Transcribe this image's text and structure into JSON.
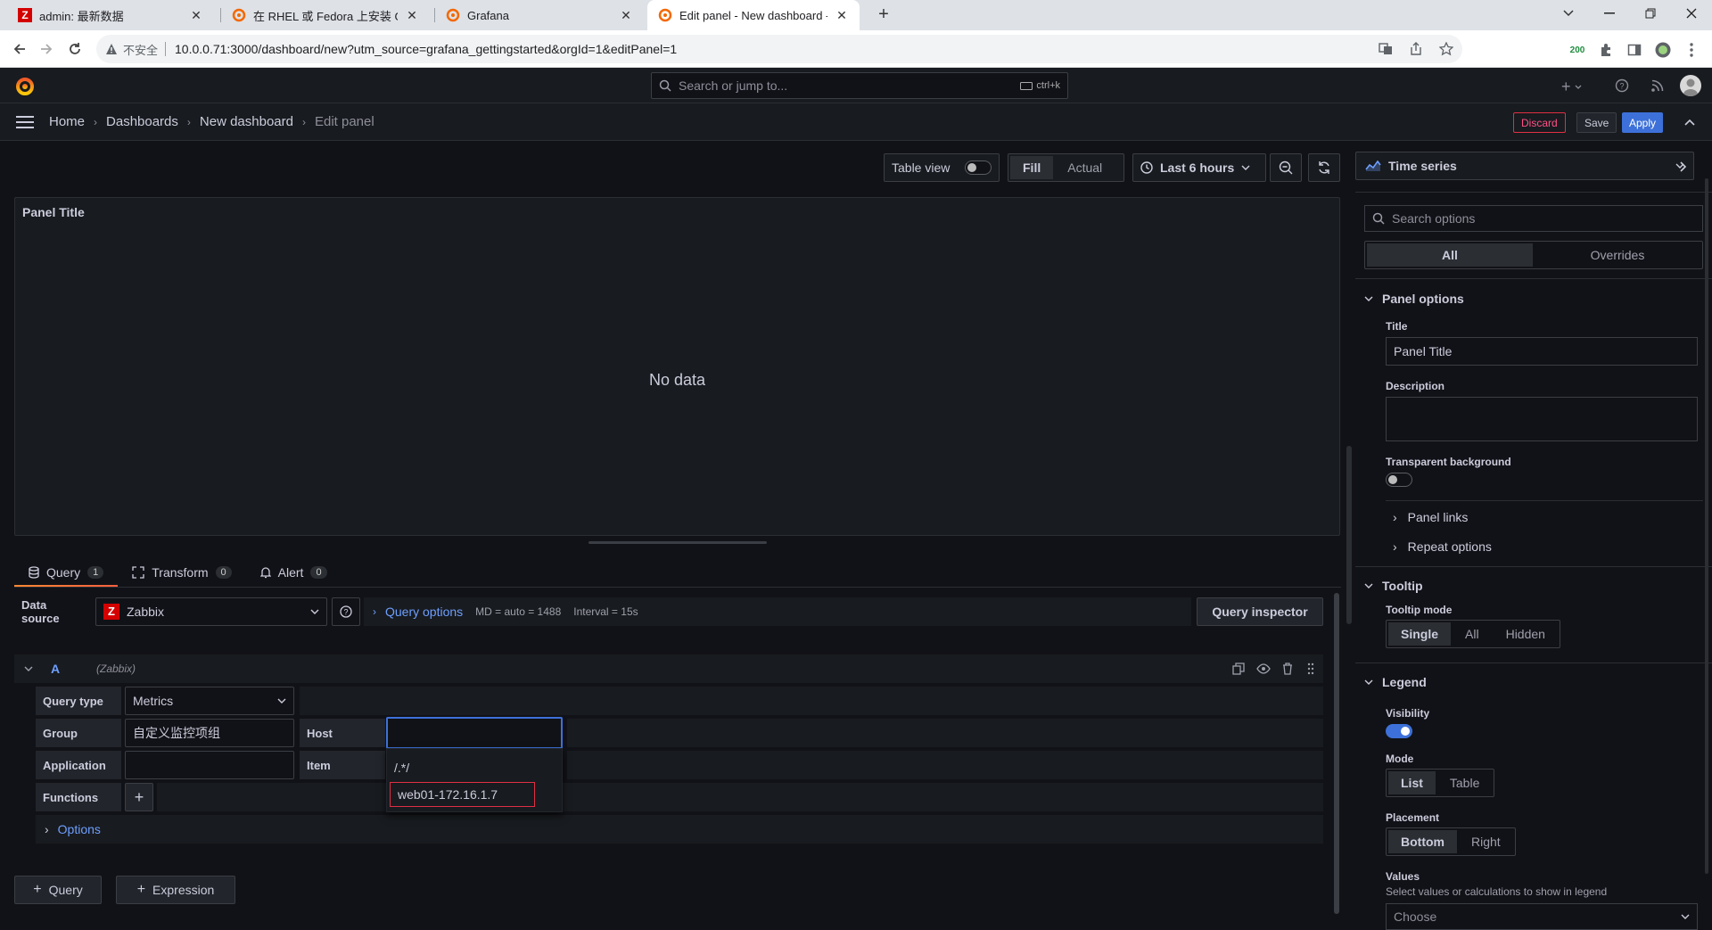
{
  "browser": {
    "tabs": [
      {
        "title": "admin: 最新数据"
      },
      {
        "title": "在 RHEL 或 Fedora 上安装 Graf"
      },
      {
        "title": "Grafana"
      },
      {
        "title": "Edit panel - New dashboard - G"
      }
    ],
    "security_label": "不安全",
    "url": "10.0.0.71:3000/dashboard/new?utm_source=grafana_gettingstarted&orgId=1&editPanel=1",
    "ext_badge": "200"
  },
  "topbar": {
    "search_placeholder": "Search or jump to...",
    "shortcut": "ctrl+k"
  },
  "breadcrumb": {
    "home": "Home",
    "dashboards": "Dashboards",
    "new_dashboard": "New dashboard",
    "edit_panel": "Edit panel"
  },
  "header_actions": {
    "discard": "Discard",
    "save": "Save",
    "apply": "Apply"
  },
  "toolbar": {
    "table_view": "Table view",
    "fill": "Fill",
    "actual": "Actual",
    "time_range": "Last 6 hours"
  },
  "panel": {
    "title": "Panel Title",
    "no_data": "No data"
  },
  "query_tabs": [
    {
      "label": "Query",
      "count": "1"
    },
    {
      "label": "Transform",
      "count": "0"
    },
    {
      "label": "Alert",
      "count": "0"
    }
  ],
  "datasource": {
    "label": "Data source",
    "value": "Zabbix",
    "query_options": "Query options",
    "md": "MD = auto = 1488",
    "interval": "Interval = 15s",
    "inspector": "Query inspector"
  },
  "query": {
    "ref": "A",
    "ds": "(Zabbix)",
    "query_type_label": "Query type",
    "query_type_value": "Metrics",
    "group_label": "Group",
    "group_value": "自定义监控项组",
    "host_label": "Host",
    "host_value": "",
    "application_label": "Application",
    "application_value": "",
    "item_label": "Item",
    "functions_label": "Functions",
    "options_label": "Options",
    "host_options": [
      "/.*/",
      "web01-172.16.1.7"
    ]
  },
  "add_buttons": {
    "query": "Query",
    "expression": "Expression"
  },
  "options_pane": {
    "visualization": "Time series",
    "search_placeholder": "Search options",
    "tab_all": "All",
    "tab_overrides": "Overrides",
    "panel_options": {
      "header": "Panel options",
      "title_label": "Title",
      "title_value": "Panel Title",
      "description_label": "Description",
      "transparent_label": "Transparent background",
      "panel_links": "Panel links",
      "repeat_options": "Repeat options"
    },
    "tooltip": {
      "header": "Tooltip",
      "mode_label": "Tooltip mode",
      "modes": [
        "Single",
        "All",
        "Hidden"
      ]
    },
    "legend": {
      "header": "Legend",
      "visibility_label": "Visibility",
      "mode_label": "Mode",
      "modes": [
        "List",
        "Table"
      ],
      "placement_label": "Placement",
      "placements": [
        "Bottom",
        "Right"
      ],
      "values_label": "Values",
      "values_desc": "Select values or calculations to show in legend",
      "values_placeholder": "Choose"
    }
  },
  "colors": {
    "accent_blue": "#3d71d9",
    "link_blue": "#6e9fff",
    "danger": "#e02f44",
    "brand_orange": "#f55f3e"
  }
}
